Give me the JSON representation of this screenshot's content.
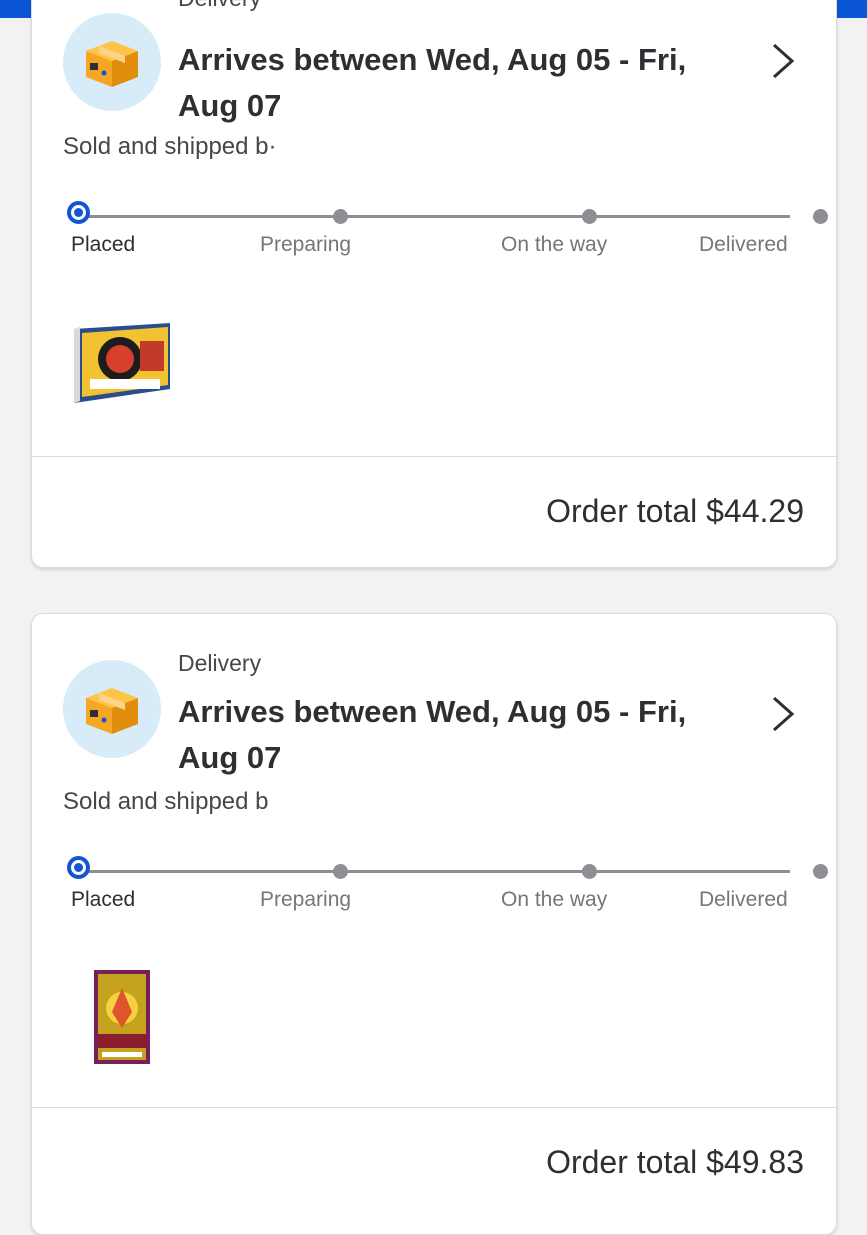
{
  "colors": {
    "accent": "#0a56d6",
    "active_step": "#1354d4",
    "inactive_step": "#8e8e94",
    "icon_bg": "#d7ecf8",
    "box": "#f5a623"
  },
  "orders": [
    {
      "delivery_label": "Delivery",
      "arrival": "Arrives between Wed, Aug 05 - Fri, Aug 07",
      "seller": "Sold and shipped b·",
      "steps": [
        "Placed",
        "Preparing",
        "On the way",
        "Delivered"
      ],
      "active_step": "Placed",
      "product_icon": "trading-card-box-icon",
      "order_total": "Order total $44.29"
    },
    {
      "delivery_label": "Delivery",
      "arrival": "Arrives between Wed, Aug 05 - Fri, Aug 07",
      "seller": "Sold and shipped b",
      "steps": [
        "Placed",
        "Preparing",
        "On the way",
        "Delivered"
      ],
      "active_step": "Placed",
      "product_icon": "trading-card-pack-icon",
      "order_total": "Order total $49.83"
    }
  ]
}
